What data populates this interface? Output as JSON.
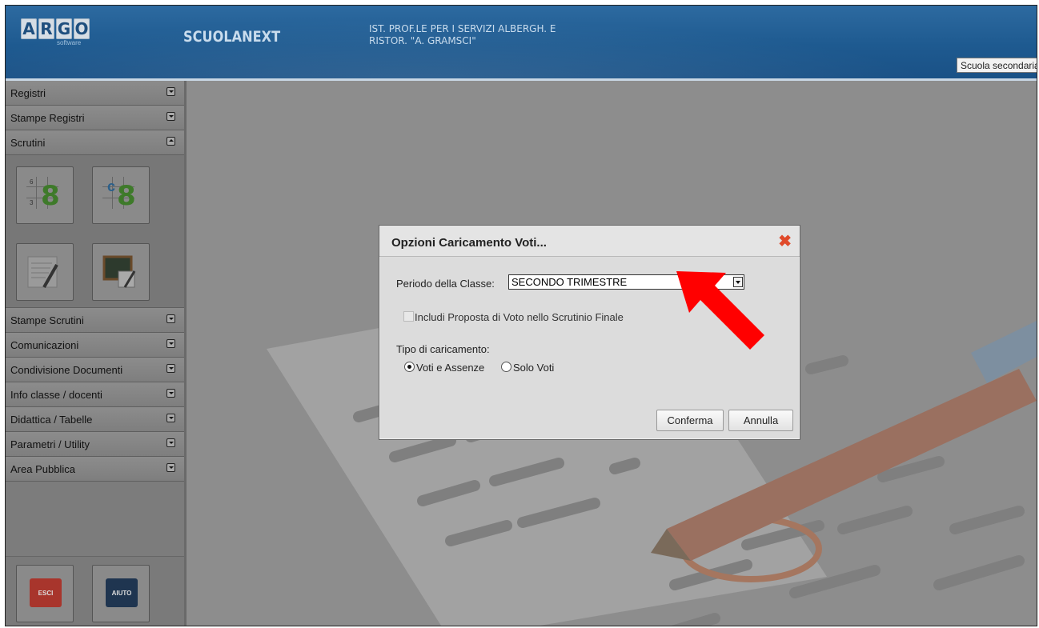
{
  "header": {
    "logo_letters": [
      "A",
      "R",
      "G",
      "O"
    ],
    "logo_sub": "software",
    "app_name": "SCUOLANEXT",
    "school_line1": "IST. PROF.LE PER I SERVIZI ALBERGH. E",
    "school_line2": "RISTOR. \"A. GRAMSCI\"",
    "school_select": "Scuola secondaria"
  },
  "sidebar": {
    "items_top": [
      {
        "label": "Registri"
      },
      {
        "label": "Stampe Registri"
      },
      {
        "label": "Scrutini"
      }
    ],
    "items_bottom": [
      {
        "label": "Stampe Scrutini"
      },
      {
        "label": "Comunicazioni"
      },
      {
        "label": "Condivisione Documenti"
      },
      {
        "label": "Info classe / docenti"
      },
      {
        "label": "Didattica / Tabelle"
      },
      {
        "label": "Parametri / Utility"
      },
      {
        "label": "Area Pubblica"
      }
    ],
    "tiles": {
      "digit": "8",
      "small_6": "6",
      "small_3": "3",
      "refresh": "c"
    },
    "esci_label": "ESCI",
    "aiuto_label": "AIUTO"
  },
  "dialog": {
    "title": "Opzioni Caricamento Voti...",
    "periodo_label": "Periodo della Classe:",
    "periodo_value": "SECONDO TRIMESTRE",
    "checkbox_label": "Includi Proposta di Voto nello Scrutinio Finale",
    "tipo_label": "Tipo di caricamento:",
    "radio1_label": "Voti e Assenze",
    "radio2_label": "Solo Voti",
    "confirm_label": "Conferma",
    "cancel_label": "Annulla",
    "close_glyph": "✖"
  },
  "colors": {
    "header_blue": "#1e5a90",
    "overlay_gray": "#8d8d8d",
    "arrow_red": "#ff0000",
    "close_red": "#e04a2a"
  }
}
